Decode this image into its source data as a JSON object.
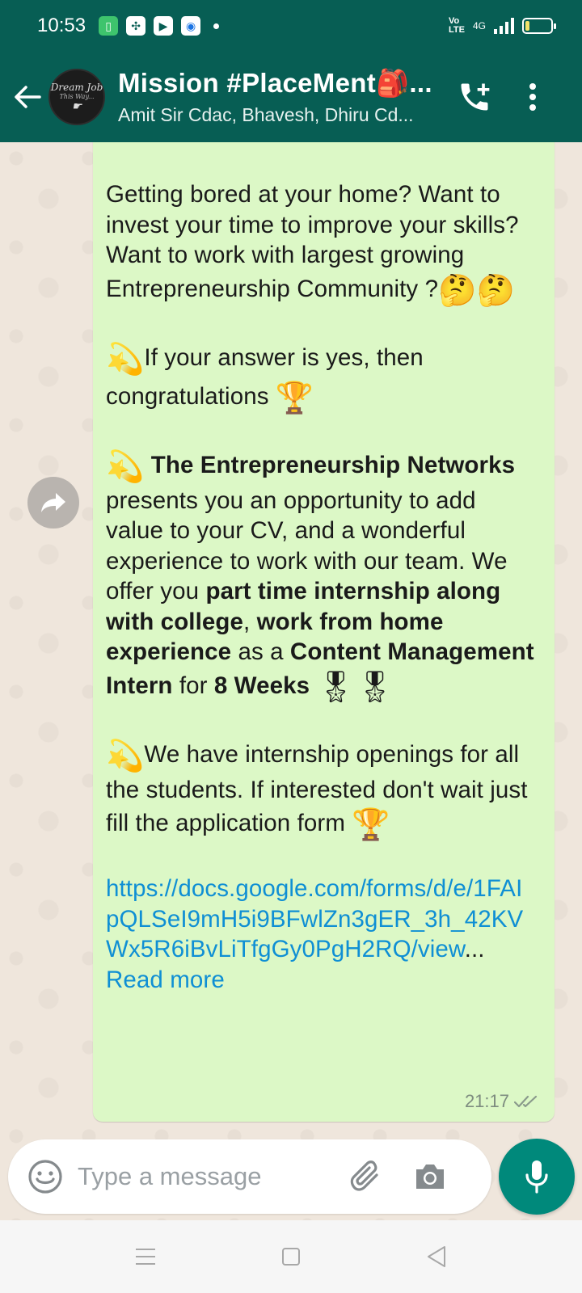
{
  "status_bar": {
    "time": "10:53",
    "network_label": "4G",
    "volte_label": "Vo LTE",
    "battery_level_percent": 15
  },
  "header": {
    "group_name": "Mission #PlaceMent🎒...",
    "members": "Amit Sir Cdac, Bhavesh, Dhiru Cd...",
    "avatar_text_line1": "Dream Job",
    "avatar_text_line2": "This Way...",
    "colors": {
      "bar": "#075e54"
    }
  },
  "message": {
    "p1_text": "Getting bored at your home? Want to invest your time to improve your skills? Want to work with largest growing Entrepreneurship Community ?",
    "p1_emojis": "🤔🤔",
    "p2_emoji": "💫",
    "p2_text": "If your answer is yes, then congratulations",
    "p2_trophy": "🏆",
    "p3_emoji": "💫",
    "p3_org": "The Entrepreneurship Networks",
    "p3_text1": "presents you an opportunity to add value to your CV, and a wonderful experience to work with our team. We offer you",
    "p3_bold1": "part time internship along with college",
    "p3_comma": ",",
    "p3_bold2": "work from home experience",
    "p3_text2": "as a",
    "p3_bold3": "Content Management Intern",
    "p3_text3": "for",
    "p3_bold4": "8 Weeks",
    "p3_medals": "🎖🎖",
    "p4_emoji": "💫",
    "p4_text": "We have internship openings for all the students. If interested don't wait just fill the application form",
    "p4_trophy": "🏆",
    "link": "https://docs.google.com/forms/d/e/1FAIpQLSeI9mH5i9BFwlZn3gER_3h_42KVWx5R6iBvLiTfgGy0PgH2RQ/view",
    "ellipsis": "...",
    "read_more": "Read more",
    "time": "21:17",
    "bubble_color": "#dcf8c6"
  },
  "input": {
    "placeholder": "Type a message"
  },
  "icons": {
    "back": "arrow-left-icon",
    "call": "add-call-icon",
    "menu": "more-vertical-icon",
    "forward": "forward-icon",
    "emoji": "smiley-icon",
    "attach": "paperclip-icon",
    "camera": "camera-icon",
    "mic": "mic-icon",
    "ticks": "double-check-icon"
  },
  "colors": {
    "accent": "#00897b",
    "link": "#0f8fd4"
  }
}
